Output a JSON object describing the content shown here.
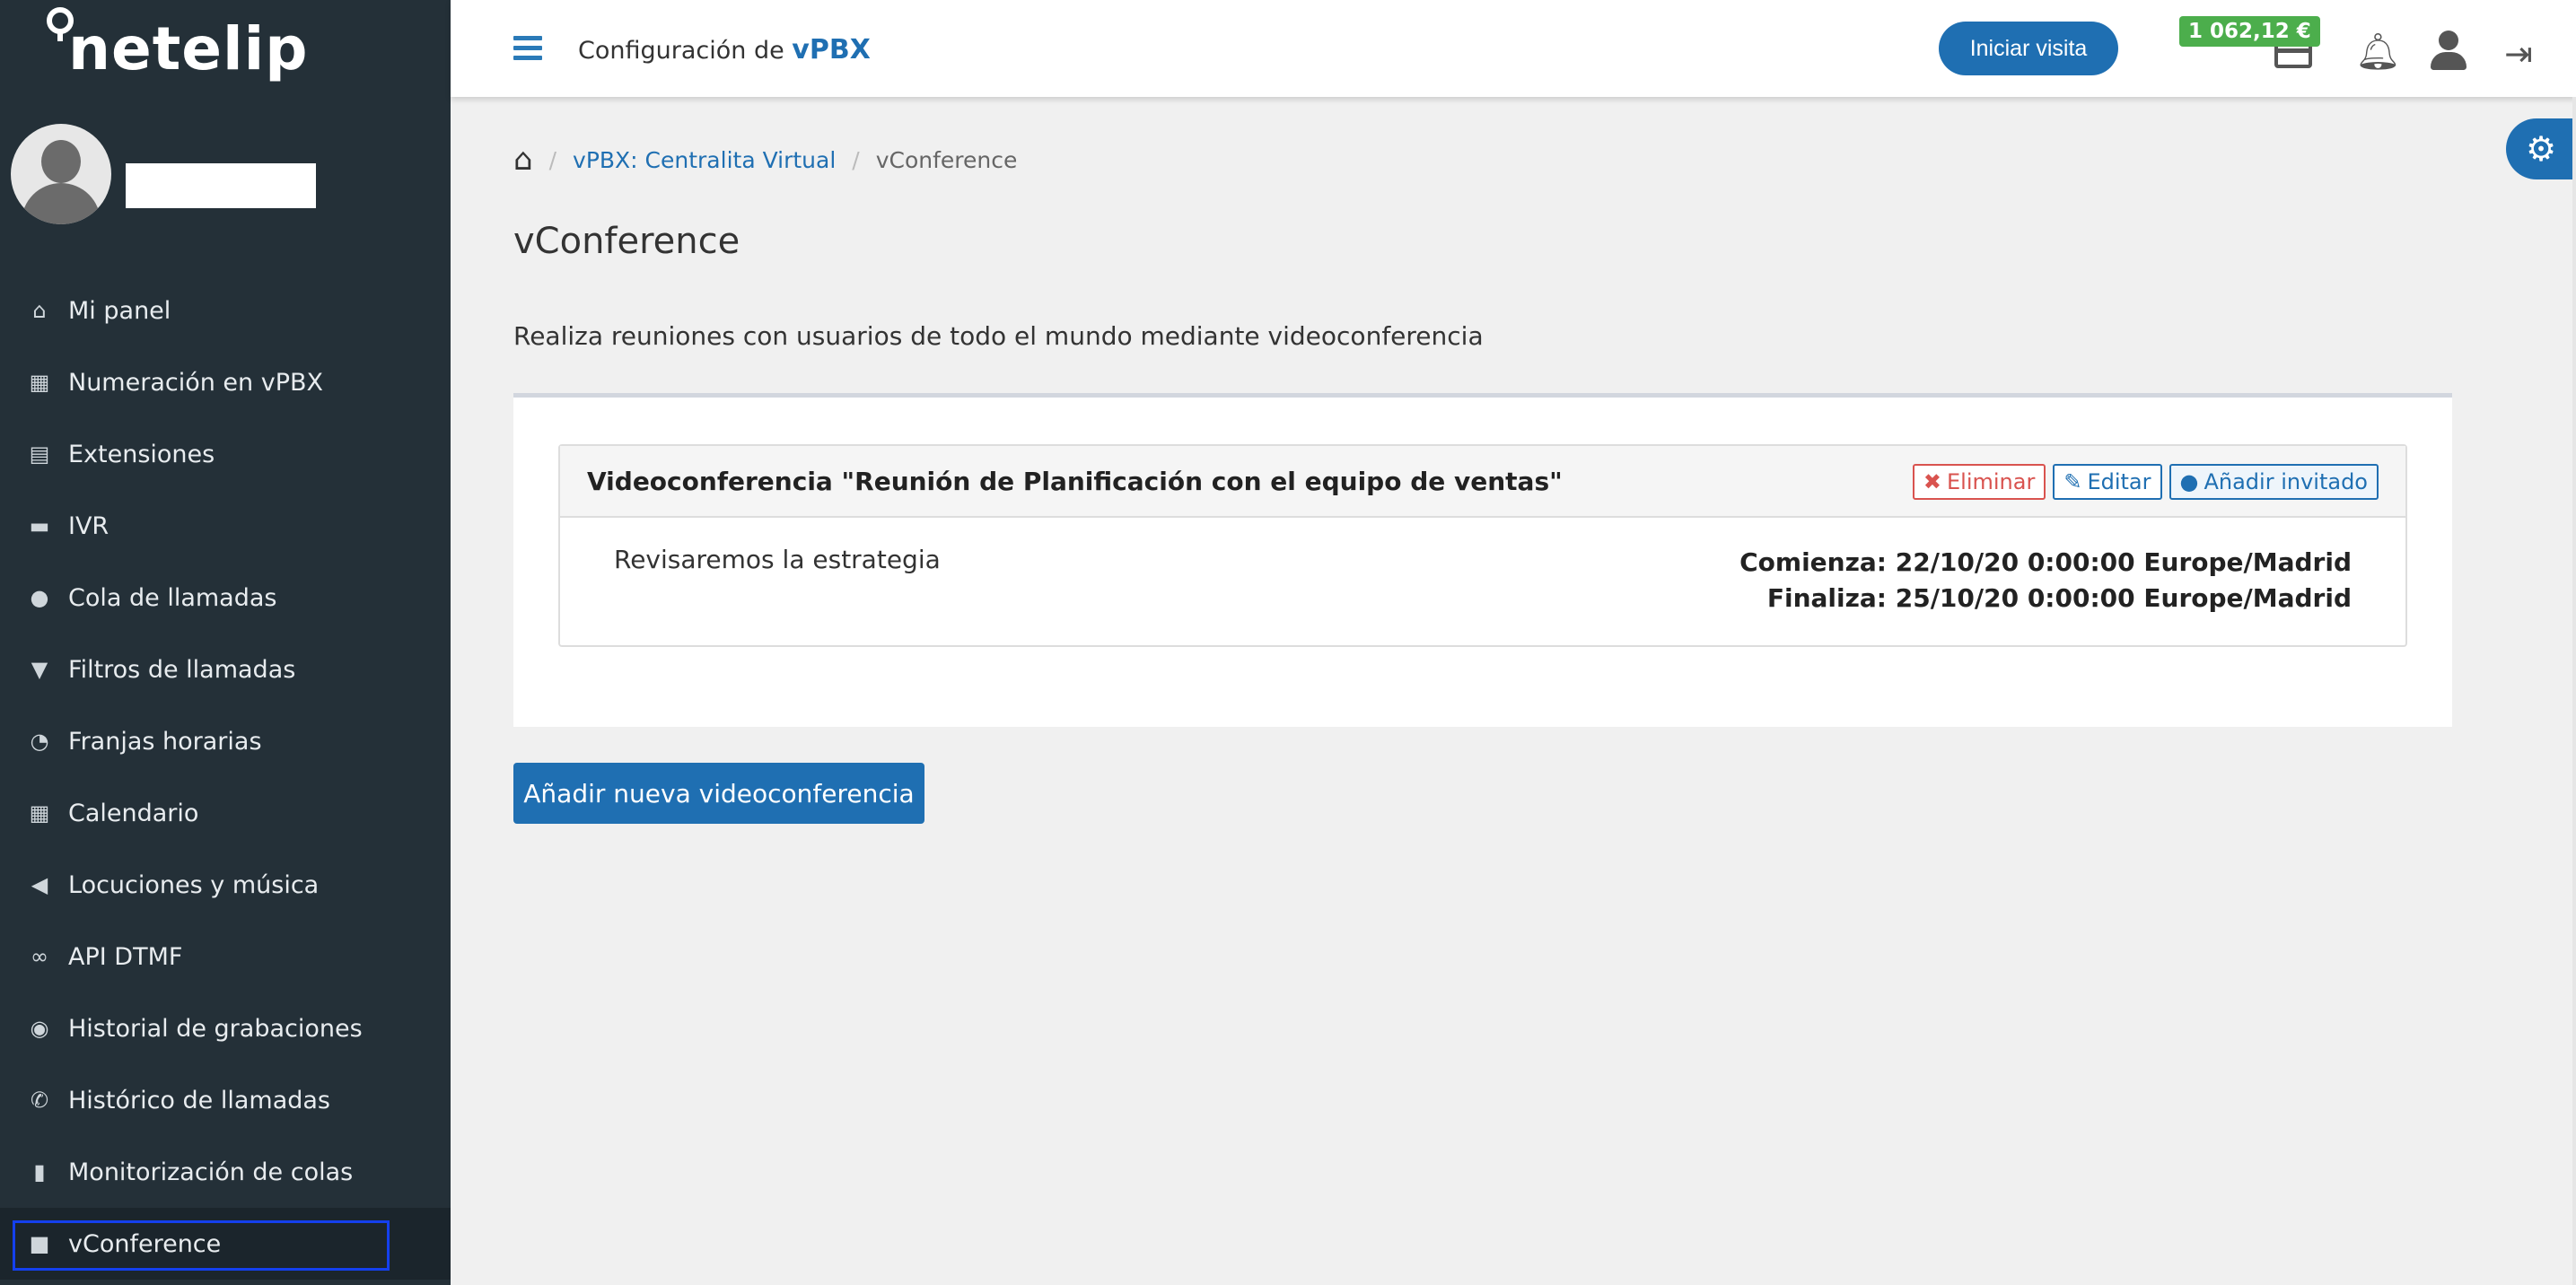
{
  "brand": {
    "logo_text": "netelip"
  },
  "sidebar": {
    "items": [
      {
        "label": "Mi panel",
        "icon": "home-icon",
        "glyph": "⌂"
      },
      {
        "label": "Numeración en vPBX",
        "icon": "grid-icon",
        "glyph": "▦"
      },
      {
        "label": "Extensiones",
        "icon": "list-icon",
        "glyph": "▤"
      },
      {
        "label": "IVR",
        "icon": "chat-icon",
        "glyph": "▬"
      },
      {
        "label": "Cola de llamadas",
        "icon": "user-icon",
        "glyph": "●"
      },
      {
        "label": "Filtros de llamadas",
        "icon": "filter-icon",
        "glyph": "▼"
      },
      {
        "label": "Franjas horarias",
        "icon": "clock-icon",
        "glyph": "◔"
      },
      {
        "label": "Calendario",
        "icon": "calendar-icon",
        "glyph": "▦"
      },
      {
        "label": "Locuciones y música",
        "icon": "volume-icon",
        "glyph": "◀"
      },
      {
        "label": "API DTMF",
        "icon": "link-icon",
        "glyph": "∞"
      },
      {
        "label": "Historial de grabaciones",
        "icon": "record-icon",
        "glyph": "◉"
      },
      {
        "label": "Histórico de llamadas",
        "icon": "phone-icon",
        "glyph": "✆"
      },
      {
        "label": "Monitorización de colas",
        "icon": "bar-chart-icon",
        "glyph": "▮"
      },
      {
        "label": "vConference",
        "icon": "video-camera-icon",
        "glyph": "■"
      }
    ]
  },
  "topbar": {
    "title_prefix": "Configuración de ",
    "title_brand": "vPBX",
    "visit_button": "Iniciar visita",
    "balance": "1 062,12 €"
  },
  "breadcrumb": {
    "link": "vPBX: Centralita Virtual",
    "current": "vConference"
  },
  "page": {
    "title": "vConference",
    "description": "Realiza reuniones con usuarios de todo el mundo mediante videoconferencia"
  },
  "conference": {
    "title": "Videoconferencia \"Reunión de Planificación con el equipo de ventas\"",
    "delete_label": "Eliminar",
    "edit_label": "Editar",
    "invite_label": "Añadir invitado",
    "description": "Revisaremos la estrategia",
    "start": "Comienza: 22/10/20 0:00:00 Europe/Madrid",
    "end": "Finaliza: 25/10/20 0:00:00 Europe/Madrid"
  },
  "actions": {
    "add_conference": "Añadir nueva videoconferencia"
  },
  "colors": {
    "sidebar": "#243038",
    "accent": "#1f6fb2",
    "balance": "#4cae4c",
    "danger": "#d9534f"
  }
}
